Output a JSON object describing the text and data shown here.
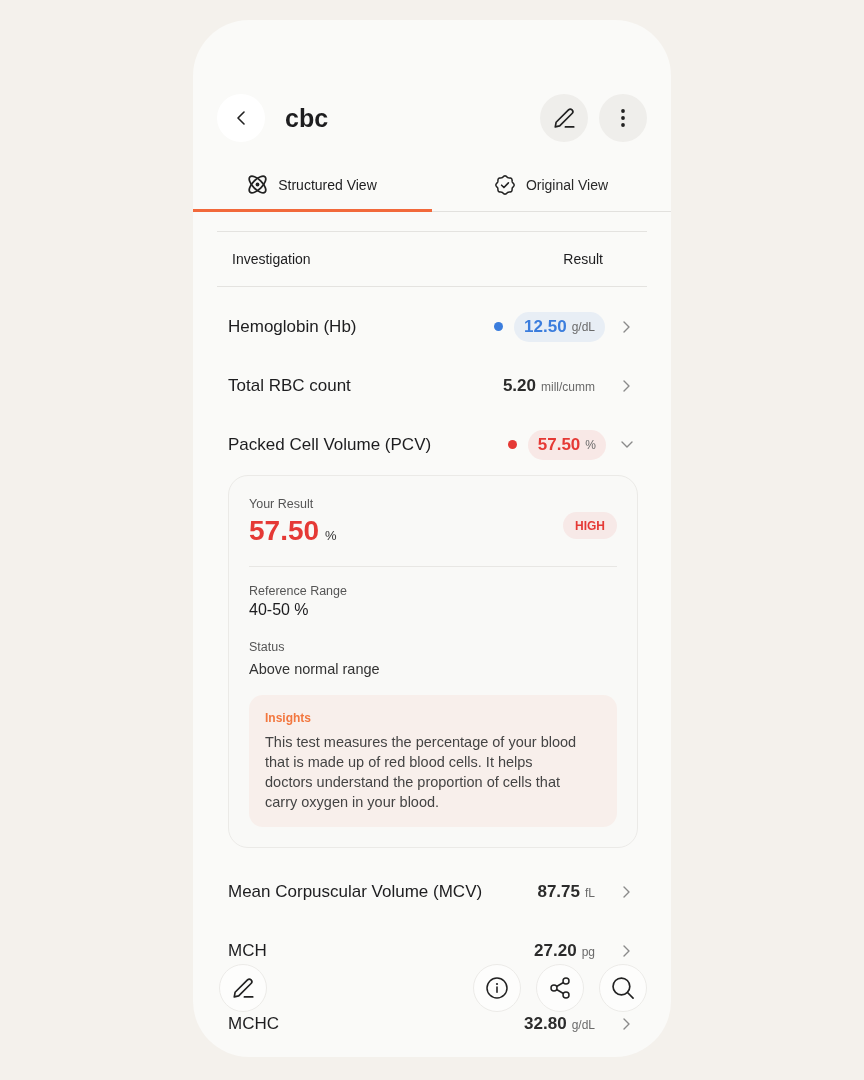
{
  "header": {
    "title": "cbc"
  },
  "tabs": [
    {
      "label": "Structured View",
      "selected": true
    },
    {
      "label": "Original View",
      "selected": false
    }
  ],
  "table": {
    "columns": [
      "Investigation",
      "Result"
    ],
    "rows": [
      {
        "name": "Hemoglobin (Hb)",
        "value": "12.50",
        "unit": "g/dL",
        "color": "#3b7ddd",
        "expanded": false
      },
      {
        "name": "Total RBC count",
        "value": "5.20",
        "unit": "mill/cumm",
        "expanded": false
      },
      {
        "name": "Packed Cell Volume (PCV)",
        "value": "57.50",
        "unit": "%",
        "color": "#e53935",
        "expanded": true,
        "detail": {
          "result_label": "Your Result",
          "value": "57.50",
          "unit": "%",
          "badge": "HIGH",
          "reference_label": "Reference Range",
          "reference": "40-50 %",
          "status_label": "Status",
          "status": "Above normal range",
          "insights": {
            "title": "Insights",
            "text": "This test measures the percentage of your blood that is made up of red blood cells. It helps doctors understand the proportion of cells that carry oxygen in your blood."
          }
        }
      },
      {
        "name": "Mean Corpuscular Volume (MCV)",
        "value": "87.75",
        "unit": "fL",
        "expanded": false
      },
      {
        "name": "MCH",
        "value": "27.20",
        "unit": "pg",
        "expanded": false
      },
      {
        "name": "MCHC",
        "value": "32.80",
        "unit": "g/dL",
        "expanded": false
      }
    ]
  }
}
